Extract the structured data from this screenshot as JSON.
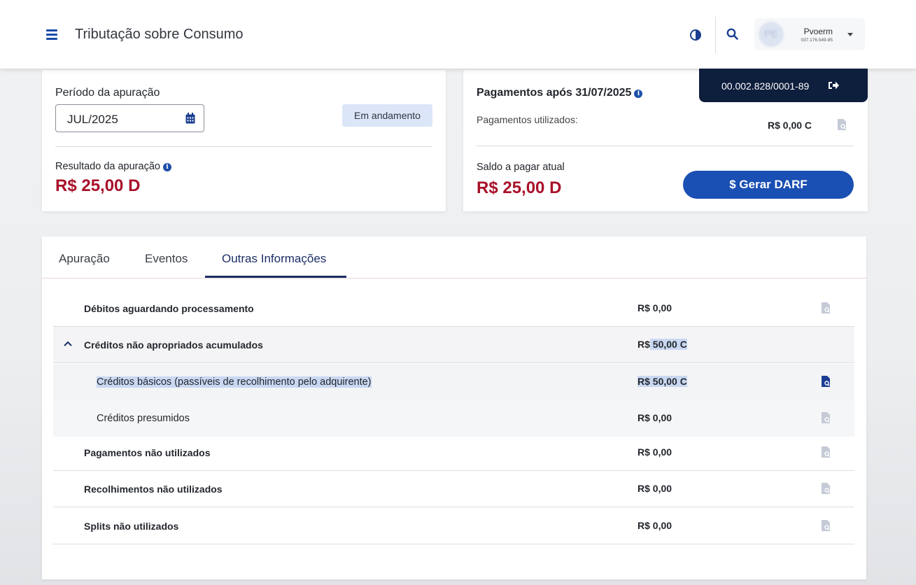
{
  "header": {
    "app_title": "Tributação sobre Consumo",
    "user": {
      "initials": "PE",
      "name": "Pvoerm",
      "cpf": "037.176.549-85"
    }
  },
  "cnpj": "00.002.828/0001-89",
  "period_card": {
    "period_label": "Período da apuração",
    "period_value": "JUL/2025",
    "status": "Em andamento",
    "result_label": "Resultado da apuração",
    "result_value": "R$ 25,00 D"
  },
  "payment_card": {
    "title": "Pagamentos após 31/07/2025",
    "used_label": "Pagamentos utilizados:",
    "used_value": "R$ 0,00 C",
    "balance_label": "Saldo a pagar atual",
    "balance_value": "R$ 25,00 D",
    "darf_button": "$ Gerar DARF"
  },
  "tabs": [
    "Apuração",
    "Eventos",
    "Outras Informações"
  ],
  "rows": [
    {
      "label": "Débitos aguardando processamento",
      "value": "R$ 0,00"
    },
    {
      "label": "Créditos não apropriados acumulados",
      "value_prefix": "R$",
      "value_rest": " 50,00 C"
    },
    {
      "label": "Créditos básicos (passíveis de recolhimento pelo adquirente)",
      "value": "R$ 50,00 C"
    },
    {
      "label": "Créditos presumidos",
      "value": "R$ 0,00"
    },
    {
      "label": "Pagamentos não utilizados",
      "value": "R$ 0,00"
    },
    {
      "label": "Recolhimentos não utilizados",
      "value": "R$ 0,00"
    },
    {
      "label": "Splits não utilizados",
      "value": "R$ 0,00"
    }
  ],
  "colors": {
    "brand_blue": "#1a4fb3",
    "navy": "#0e1e3d",
    "debit_red": "#a8112a",
    "selection": "#c9d8f2"
  }
}
